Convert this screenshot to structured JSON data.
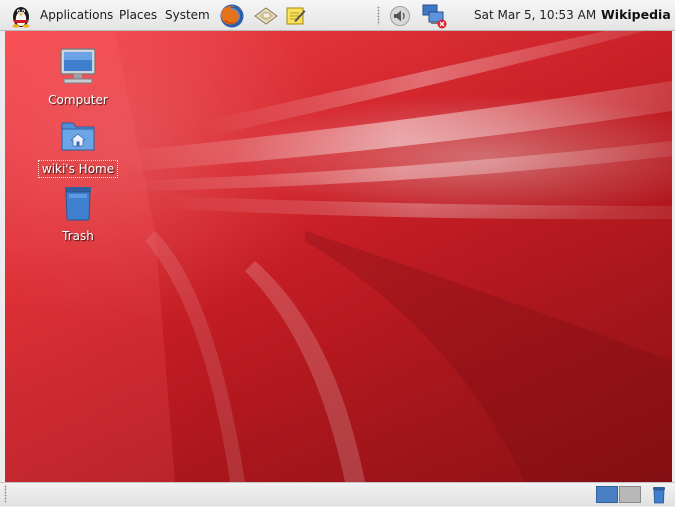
{
  "top_panel": {
    "menus": [
      "Applications",
      "Places",
      "System"
    ],
    "clock": "Sat Mar  5, 10:53 AM",
    "user": "Wikipedia",
    "launchers": [
      "firefox-icon",
      "email-icon",
      "notes-icon"
    ],
    "tray": [
      "volume-icon",
      "network-icon"
    ]
  },
  "desktop": {
    "icons": [
      {
        "label": "Computer",
        "icon": "computer-icon",
        "selected": false
      },
      {
        "label": "wiki's Home",
        "icon": "home-folder-icon",
        "selected": true
      },
      {
        "label": "Trash",
        "icon": "trash-icon",
        "selected": false
      }
    ],
    "wallpaper_color": "#e02a31"
  },
  "bottom_panel": {
    "workspaces": [
      "workspace-1",
      "workspace-2"
    ],
    "active_workspace": 1
  }
}
